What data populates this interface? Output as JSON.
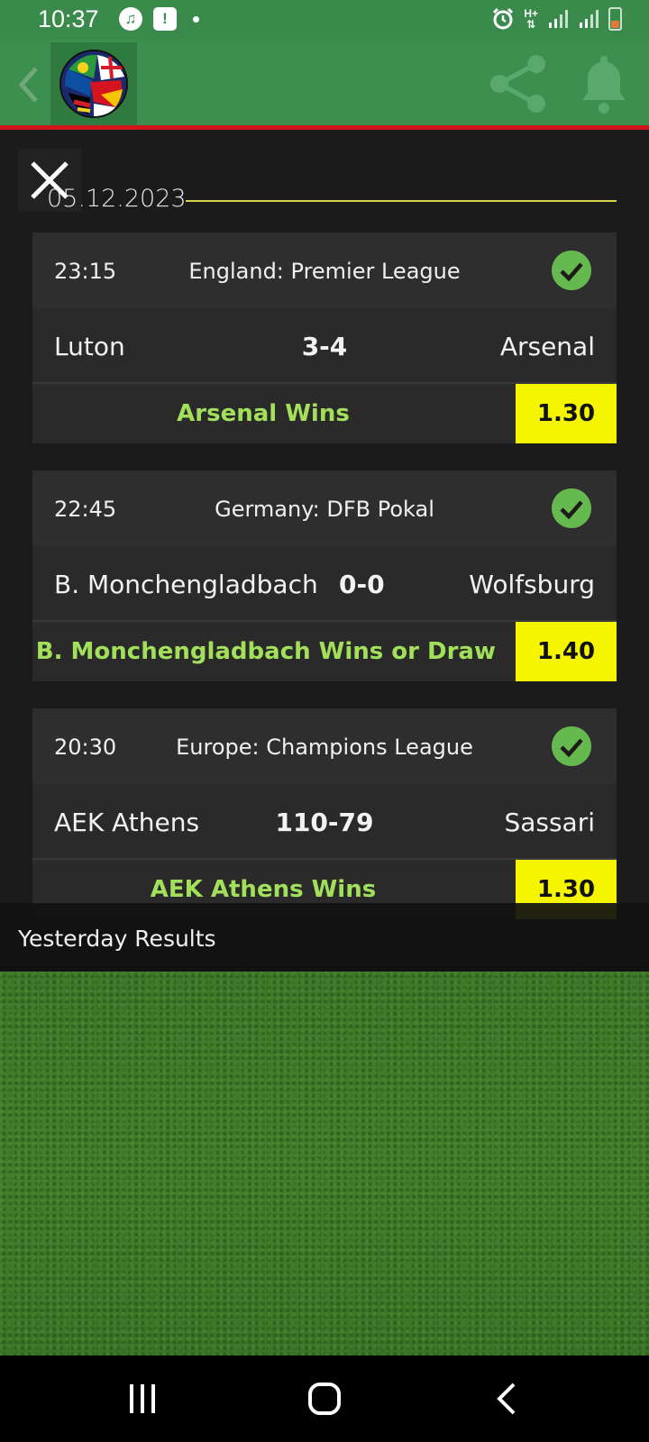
{
  "status_bar": {
    "time": "10:37",
    "network": "H+",
    "icons": [
      "music-icon",
      "alert-icon",
      "dot-icon",
      "alarm-icon",
      "signal-icon",
      "signal-icon",
      "battery-icon"
    ]
  },
  "app_bar": {
    "back_icon": "chevron-left-icon",
    "logo": "flag-soccer-ball-logo",
    "actions": [
      "share-icon",
      "bell-icon"
    ]
  },
  "panel": {
    "close_icon": "close-icon",
    "date": "05.12.2023",
    "matches": [
      {
        "time": "23:15",
        "league": "England: Premier League",
        "home": "Luton",
        "score": "3-4",
        "away": "Arsenal",
        "tip": "Arsenal Wins",
        "odds": "1.30",
        "status": "won"
      },
      {
        "time": "22:45",
        "league": "Germany: DFB Pokal",
        "home": "B. Monchengladbach",
        "score": "0-0",
        "away": "Wolfsburg",
        "tip": "B. Monchengladbach Wins or Draw",
        "odds": "1.40",
        "status": "won"
      },
      {
        "time": "20:30",
        "league": "Europe: Champions League",
        "home": "AEK Athens",
        "score": "110-79",
        "away": "Sassari",
        "tip": "AEK Athens Wins",
        "odds": "1.30",
        "status": "won"
      }
    ],
    "section_label": "Yesterday Results"
  },
  "colors": {
    "status_bar": "#3a8a4c",
    "app_bar": "#3d8f50",
    "accent_red": "#d0161b",
    "tip_green": "#a2e05c",
    "odds_yellow": "#f6f500",
    "check_green": "#66b94e"
  },
  "nav_bar": [
    "recent-apps-icon",
    "home-icon",
    "back-icon"
  ]
}
